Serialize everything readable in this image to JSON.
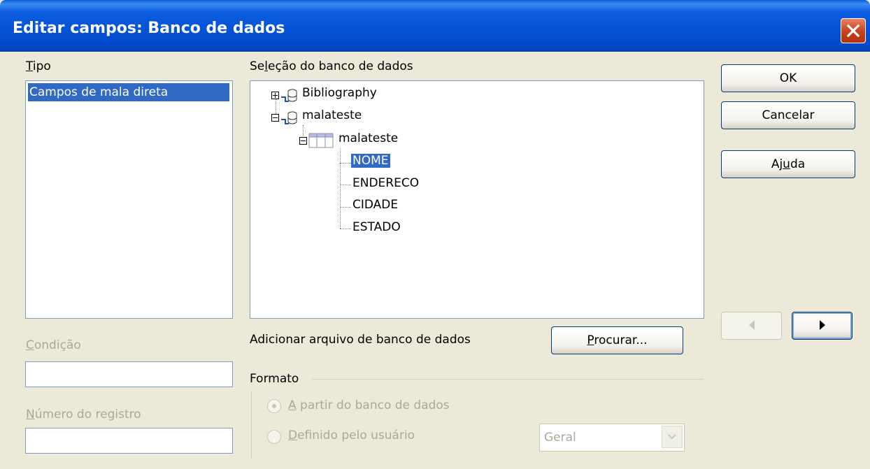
{
  "window": {
    "title": "Editar campos: Banco de dados"
  },
  "tipo": {
    "label_prefix": "",
    "label_u": "T",
    "label_rest": "ipo",
    "items": [
      "Campos de mala direta"
    ]
  },
  "condicao": {
    "label_u": "C",
    "label_rest": "ondição",
    "value": ""
  },
  "numero": {
    "label_u": "N",
    "label_rest": "úmero do registro",
    "value": ""
  },
  "selecao": {
    "label_pre": "Se",
    "label_u": "l",
    "label_rest": "eção do banco de dados",
    "tree": {
      "db1": "Bibliography",
      "db2": "malateste",
      "table": "malateste",
      "fields": [
        "NOME",
        "ENDERECO",
        "CIDADE",
        "ESTADO"
      ]
    }
  },
  "add_db": {
    "label": "Adicionar arquivo de banco de dados"
  },
  "procurar": {
    "label_u": "P",
    "label_rest": "rocurar..."
  },
  "formato": {
    "label": "Formato",
    "radio1_u": "A",
    "radio1_rest": " partir do banco de dados",
    "radio2_u": "D",
    "radio2_rest": "efinido pelo usuário",
    "combo_value": "Geral"
  },
  "buttons": {
    "ok": "OK",
    "cancel": "Cancelar",
    "help_pre": "Aj",
    "help_u": "u",
    "help_rest": "da"
  },
  "icons": {
    "close": "close-icon",
    "prev": "arrow-left-icon",
    "next": "arrow-right-icon",
    "database": "database-icon",
    "table": "table-icon"
  }
}
